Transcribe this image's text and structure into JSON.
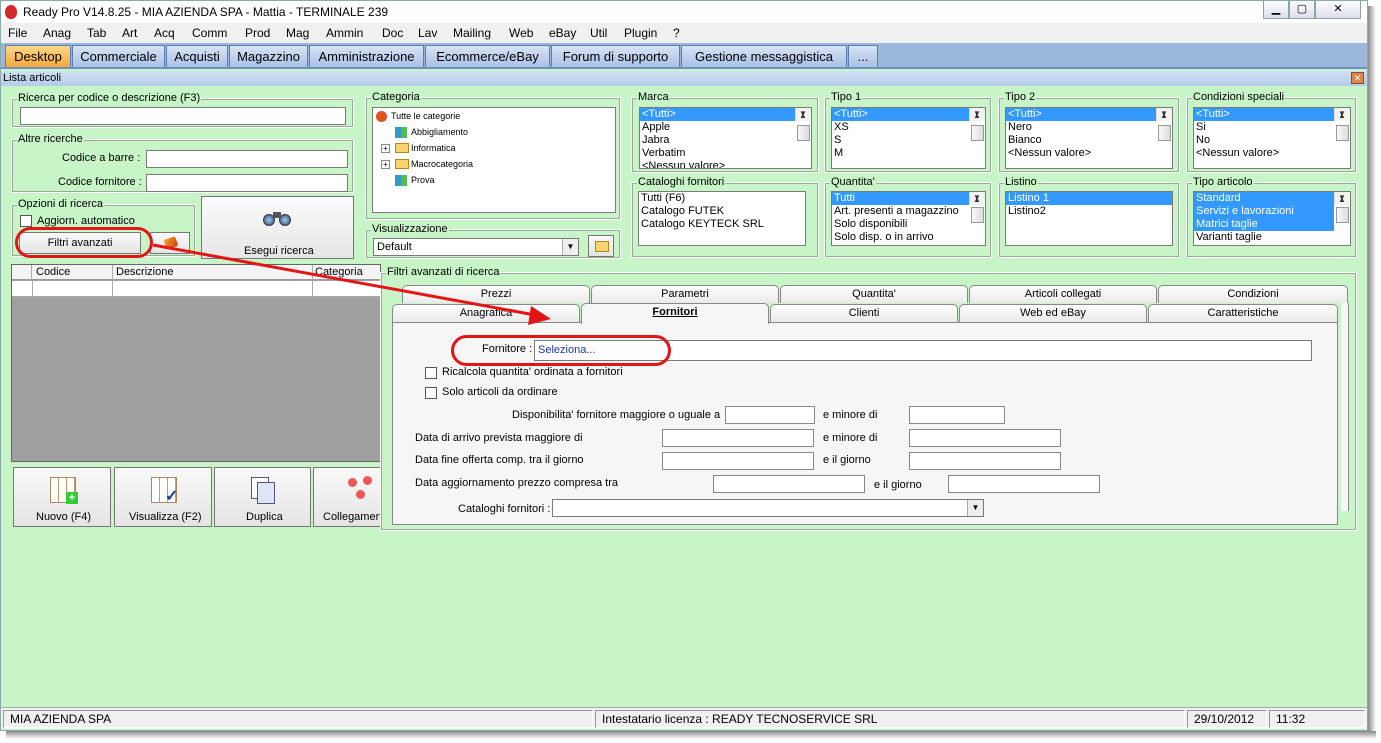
{
  "window": {
    "title": "Ready Pro V14.8.25 - MIA AZIENDA SPA - Mattia - TERMINALE 239",
    "min": "▁",
    "max": "▢",
    "close": "✕"
  },
  "menu": [
    "File",
    "Anag",
    "Tab",
    "Art",
    "Acq",
    "Comm",
    "Prod",
    "Mag",
    "Ammin",
    "Doc",
    "Lav",
    "Mailing",
    "Web",
    "eBay",
    "Util",
    "Plugin",
    "?"
  ],
  "tabs": [
    "Desktop",
    "Commerciale",
    "Acquisti",
    "Magazzino",
    "Amministrazione",
    "Ecommerce/eBay",
    "Forum di supporto",
    "Gestione messaggistica",
    "..."
  ],
  "subwindow": {
    "title": "Lista articoli",
    "close": "✕"
  },
  "search": {
    "code_label": "Ricerca per codice o descrizione (F3)",
    "other_label": "Altre ricerche",
    "barcode_label": "Codice a barre :",
    "supplier_code_label": "Codice fornitore :",
    "options_label": "Opzioni di ricerca",
    "auto_update_label": "Aggiorn. automatico",
    "advanced_button": "Filtri avanzati",
    "run_button": "Esegui ricerca"
  },
  "category": {
    "label": "Categoria",
    "items": [
      "Tutte le categorie",
      "Abbigliamento",
      "Informatica",
      "Macrocategoria",
      "Prova"
    ]
  },
  "view": {
    "label": "Visualizzazione",
    "value": "Default"
  },
  "brand": {
    "label": "Marca",
    "items": [
      "<Tutti>",
      "Apple",
      "Jabra",
      "Verbatim",
      "<Nessun valore>"
    ]
  },
  "type1": {
    "label": "Tipo 1",
    "items": [
      "<Tutti>",
      "XS",
      "S",
      "M"
    ]
  },
  "type2": {
    "label": "Tipo 2",
    "items": [
      "<Tutti>",
      "Nero",
      "Bianco",
      "<Nessun valore>"
    ]
  },
  "special": {
    "label": "Condizioni speciali",
    "items": [
      "<Tutti>",
      "Si",
      "No",
      "<Nessun valore>"
    ]
  },
  "catalogs": {
    "label": "Cataloghi fornitori",
    "items": [
      "Tutti (F6)",
      "Catalogo FUTEK",
      "Catalogo KEYTECK SRL"
    ]
  },
  "quantity": {
    "label": "Quantita'",
    "items": [
      "Tutti",
      "Art. presenti a magazzino",
      "Solo disponibili",
      "Solo disp. o in arrivo"
    ]
  },
  "pricelist": {
    "label": "Listino",
    "items": [
      "Listino 1",
      "Listino2"
    ]
  },
  "article_type": {
    "label": "Tipo articolo",
    "items": [
      "Standard",
      "Servizi e lavorazioni",
      "Matrici taglie",
      "Varianti taglie"
    ]
  },
  "grid": {
    "columns": [
      "Codice",
      "Descrizione",
      "Categoria"
    ]
  },
  "actions": [
    "Nuovo (F4)",
    "Visualizza (F2)",
    "Duplica",
    "Collegamenti"
  ],
  "advanced": {
    "label": "Filtri avanzati di ricerca",
    "tabs_top": [
      "Prezzi",
      "Parametri",
      "Quantita'",
      "Articoli collegati",
      "Condizioni"
    ],
    "tabs_bottom": [
      "Anagrafica",
      "Fornitori",
      "Clienti",
      "Web ed eBay",
      "Caratteristiche"
    ],
    "supplier_label": "Fornitore :",
    "supplier_value": "Seleziona...",
    "recalc_label": "Ricalcola quantita' ordinata a fornitori",
    "to_order_label": "Solo articoli da ordinare",
    "avail_label": "Disponibilita' fornitore maggiore o uguale a",
    "less_than": "e minore di",
    "arrival_label": "Data di arrivo prevista maggiore di",
    "offer_end_label": "Data fine offerta comp. tra il giorno",
    "and_day": "e il giorno",
    "price_update_label": "Data aggiornamento prezzo compresa tra",
    "catalogs_label": "Cataloghi fornitori :"
  },
  "status": {
    "company": "MIA AZIENDA SPA",
    "license": "Intestatario licenza : READY TECNOSERVICE SRL",
    "date": "29/10/2012",
    "time": "11:32"
  }
}
